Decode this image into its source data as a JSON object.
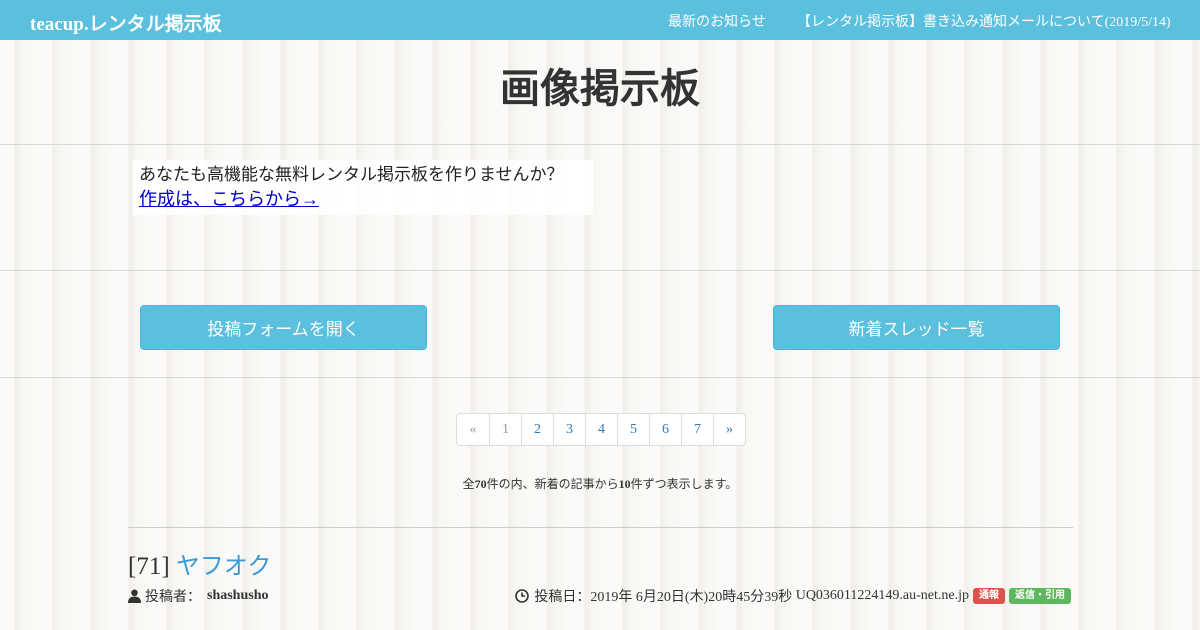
{
  "header": {
    "brand": "teacup.レンタル掲示板",
    "news_link": "最新のお知らせ",
    "notice_link": "【レンタル掲示板】書き込み通知メールについて(2019/5/14)"
  },
  "page": {
    "title": "画像掲示板"
  },
  "promo": {
    "text": "あなたも高機能な無料レンタル掲示板を作りませんか？",
    "link": "作成は、こちらから→"
  },
  "actions": {
    "open_form": "投稿フォームを開く",
    "thread_list": "新着スレッド一覧"
  },
  "pagination": {
    "prev": "«",
    "pages": [
      "1",
      "2",
      "3",
      "4",
      "5",
      "6",
      "7"
    ],
    "next": "»",
    "current": "1"
  },
  "summary": {
    "prefix": "全",
    "total": "70",
    "middle": "件の内、新着の記事から",
    "per_page": "10",
    "suffix": "件ずつ表示します。"
  },
  "post": {
    "number": "[71]",
    "subject": "ヤフオク",
    "author_label": "投稿者：",
    "author": "shashusho",
    "date_label": "投稿日：",
    "date": "2019年 6月20日(木)20時45分39秒",
    "host": "UQ036011224149.au-net.ne.jp",
    "badge_report": "通報",
    "badge_reply": "返信・引用"
  },
  "colors": {
    "header_bg": "#5bc0de",
    "button_bg": "#5bc0de",
    "link_blue": "#3a9bd6",
    "badge_red": "#d9534f",
    "badge_green": "#5cb85c"
  }
}
